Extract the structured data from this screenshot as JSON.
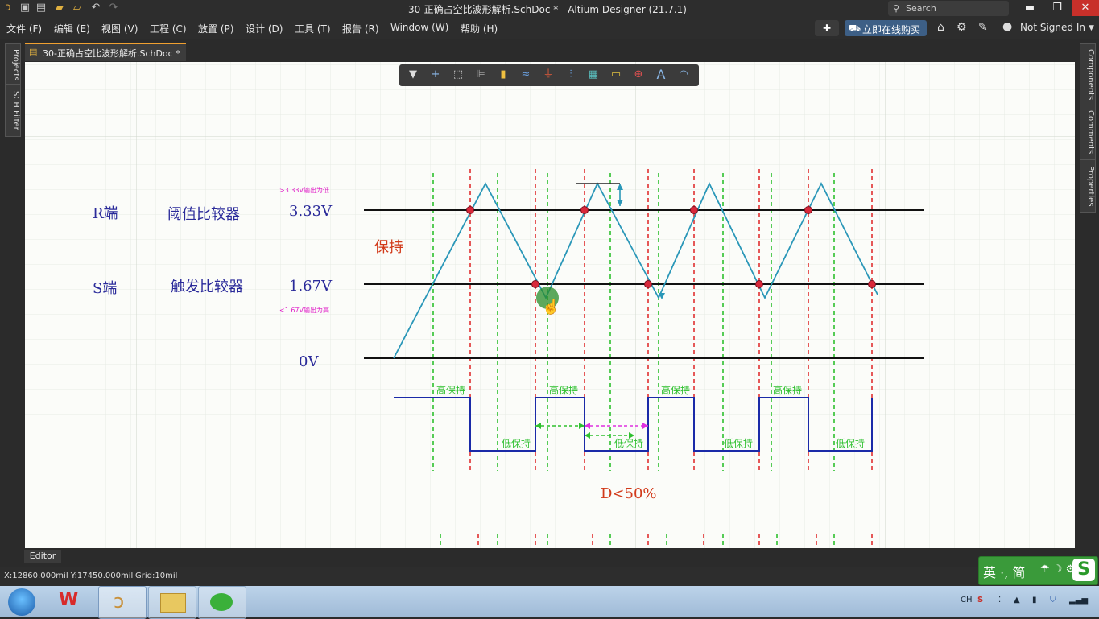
{
  "window": {
    "title": "30-正确占空比波形解析.SchDoc * - Altium Designer (21.7.1)",
    "search_placeholder": "Search",
    "controls": {
      "minimize": "▬",
      "restore": "❐",
      "close": "✕"
    }
  },
  "quick_access": [
    "save-icon",
    "save-all-icon",
    "open-icon",
    "open-project-icon",
    "undo-icon",
    "redo-icon"
  ],
  "menu": {
    "items": [
      "文件 (F)",
      "编辑 (E)",
      "视图 (V)",
      "工程 (C)",
      "放置 (P)",
      "设计 (D)",
      "工具 (T)",
      "报告 (R)",
      "Window (W)",
      "帮助 (H)"
    ],
    "buy_label": "立即在线购买",
    "signed_in": "Not Signed In"
  },
  "left_panels": [
    "Projects",
    "SCH Filter"
  ],
  "right_panels": [
    "Components",
    "Comments",
    "Properties"
  ],
  "document_tab": "30-正确占空比波形解析.SchDoc *",
  "schematic_toolbar": [
    "filter-icon",
    "crosshair-icon",
    "select-rect-icon",
    "align-icon",
    "component-icon",
    "wire-icon",
    "power-icon",
    "bus-icon",
    "harness-icon",
    "port-icon",
    "directive-icon",
    "text-icon",
    "arc-icon"
  ],
  "diagram": {
    "r_label": "R端",
    "r_desc": "阈值比较器",
    "r_voltage": "3.33V",
    "r_note": ">3.33V输出为低",
    "hold_label": "保持",
    "s_label": "S端",
    "s_desc": "触发比较器",
    "s_voltage": "1.67V",
    "s_note": "<1.67V输出为高",
    "zero_voltage": "0V",
    "high_hold": "高保持",
    "low_hold": "低保持",
    "duty_label": "D<50%"
  },
  "colors": {
    "wave": "#2a97b8",
    "red_dash": "#e03030",
    "green_dash": "#2ec02e",
    "magenta": "#e030e0",
    "output": "#1a2aa8",
    "label_blue": "#2a2a9a",
    "label_red": "#d23a1a",
    "note_magenta": "#e020c8"
  },
  "editor_tab": "Editor",
  "status": {
    "coords": "X:12860.000mil Y:17450.000mil",
    "grid": "Grid:10mil"
  },
  "ime": {
    "text": "英 ·, 简"
  },
  "taskbar": {
    "apps": [
      "start-orb-icon",
      "wps-icon",
      "altium-icon",
      "explorer-icon",
      "wechat-icon"
    ],
    "tray_lang": "CH"
  }
}
